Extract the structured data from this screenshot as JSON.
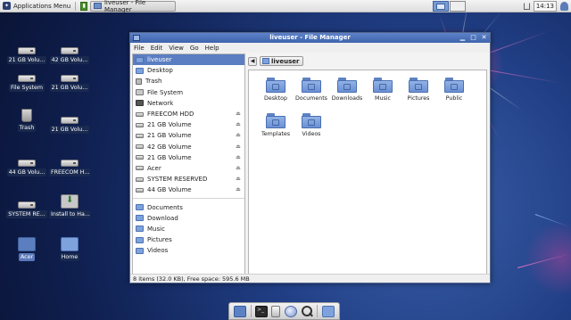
{
  "top_panel": {
    "applications_menu": "Applications Menu",
    "task_button": "liveuser - File Manager",
    "clock": "14:13"
  },
  "desktop_icons": [
    {
      "label": "21 GB Volu...",
      "kind": "drive"
    },
    {
      "label": "42 GB Volu...",
      "kind": "drive"
    },
    {
      "label": "File System",
      "kind": "drive"
    },
    {
      "label": "21 GB Volu...",
      "kind": "drive"
    },
    {
      "label": "Trash",
      "kind": "trash"
    },
    {
      "label": "21 GB Volu...",
      "kind": "drive"
    },
    {
      "label": "44 GB Volu...",
      "kind": "drive"
    },
    {
      "label": "FREECOM H...",
      "kind": "drive"
    },
    {
      "label": "SYSTEM RE...",
      "kind": "drive"
    },
    {
      "label": "Install to Ha...",
      "kind": "installer"
    },
    {
      "label": "Acer",
      "kind": "folder",
      "selected": true
    },
    {
      "label": "Home",
      "kind": "folder"
    }
  ],
  "window": {
    "title": "liveuser - File Manager",
    "menu": [
      "File",
      "Edit",
      "View",
      "Go",
      "Help"
    ],
    "sidebar_devices": [
      {
        "label": "liveuser",
        "icon": "folder",
        "selected": true
      },
      {
        "label": "Desktop",
        "icon": "folder"
      },
      {
        "label": "Trash",
        "icon": "trash"
      },
      {
        "label": "File System",
        "icon": "fs"
      },
      {
        "label": "Network",
        "icon": "net"
      },
      {
        "label": "FREECOM HDD",
        "icon": "drive",
        "eject": true
      },
      {
        "label": "21 GB Volume",
        "icon": "drive",
        "eject": true
      },
      {
        "label": "21 GB Volume",
        "icon": "drive",
        "eject": true
      },
      {
        "label": "42 GB Volume",
        "icon": "drive",
        "eject": true
      },
      {
        "label": "21 GB Volume",
        "icon": "drive",
        "eject": true
      },
      {
        "label": "Acer",
        "icon": "drive",
        "eject": true
      },
      {
        "label": "SYSTEM RESERVED",
        "icon": "drive",
        "eject": true
      },
      {
        "label": "44 GB Volume",
        "icon": "drive",
        "eject": true
      }
    ],
    "sidebar_places": [
      {
        "label": "Documents"
      },
      {
        "label": "Download"
      },
      {
        "label": "Music"
      },
      {
        "label": "Pictures"
      },
      {
        "label": "Videos"
      }
    ],
    "path": "liveuser",
    "files": [
      {
        "label": "Desktop",
        "emblem": "desktop"
      },
      {
        "label": "Documents",
        "emblem": "documents"
      },
      {
        "label": "Downloads",
        "emblem": "downloads"
      },
      {
        "label": "Music",
        "emblem": "music"
      },
      {
        "label": "Pictures",
        "emblem": "pictures"
      },
      {
        "label": "Public",
        "emblem": "public"
      },
      {
        "label": "Templates",
        "emblem": "templates"
      },
      {
        "label": "Videos",
        "emblem": "videos"
      }
    ],
    "status": "8 items (32.0 KB), Free space: 595.6 MB"
  },
  "colors": {
    "titlebar": "#3e64ad",
    "selection": "#5b7ec2",
    "folder": "#7ea2dc",
    "desktop_bg": "#213f86"
  }
}
